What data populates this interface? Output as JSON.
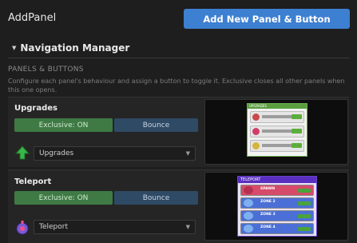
{
  "app": {
    "title": "AddPanel"
  },
  "toolbar": {
    "add_label": "Add New Panel & Button"
  },
  "section": {
    "title": "Navigation Manager"
  },
  "panels_heading": "PANELS & BUTTONS",
  "description": "Configure each panel's behaviour and assign a button to toggle it. Exclusive closes all other panels when this one opens.",
  "panels": [
    {
      "title": "Upgrades",
      "exclusive_label": "Exclusive: ON",
      "bounce_label": "Bounce",
      "button_value": "Upgrades",
      "icon": "green-up-arrow-icon",
      "preview_header": "UPGRADES"
    },
    {
      "title": "Teleport",
      "exclusive_label": "Exclusive: ON",
      "bounce_label": "Bounce",
      "button_value": "Teleport",
      "icon": "teleport-pin-icon",
      "preview_header": "TELEPORT",
      "preview_rows": [
        "SPAWN",
        "ZONE 2",
        "ZONE 3",
        "ZONE 4"
      ]
    }
  ],
  "colors": {
    "accent": "#3d7fd0",
    "exclusive_on": "#3f7a45",
    "bounce": "#2f4a64"
  }
}
